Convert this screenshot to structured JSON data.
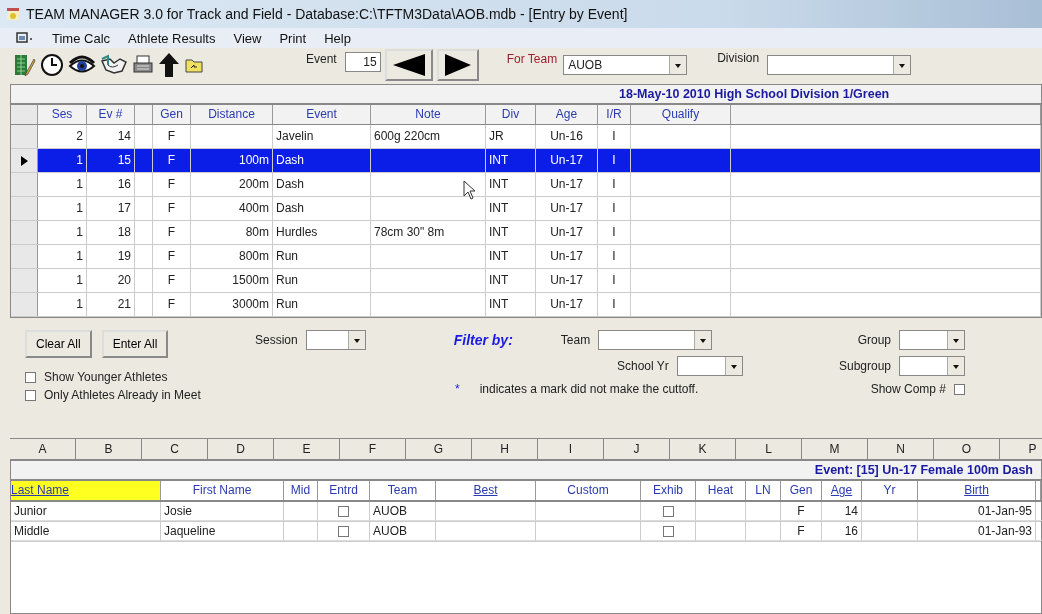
{
  "window": {
    "title": "TEAM MANAGER 3.0 for Track and Field - Database:C:\\TFTM3Data\\AOB.mdb - [Entry by Event]"
  },
  "menu": [
    "Time Calc",
    "Athlete Results",
    "View",
    "Print",
    "Help"
  ],
  "toolbar": {
    "event_label": "Event",
    "event_value": "15",
    "team_label": "For Team",
    "team_value": "AUOB",
    "division_label": "Division"
  },
  "meet_banner": "18-May-10  2010 High School Division 1/Green",
  "events": {
    "columns": [
      "Ses",
      "Ev #",
      "",
      "Gen",
      "Distance",
      "Event",
      "Note",
      "Div",
      "Age",
      "I/R",
      "Qualify"
    ],
    "rows": [
      {
        "selected": false,
        "cells": [
          "2",
          "14",
          "",
          "F",
          "",
          "Javelin",
          "600g 220cm",
          "JR",
          "Un-16",
          "I",
          ""
        ]
      },
      {
        "selected": true,
        "cells": [
          "1",
          "15",
          "",
          "F",
          "100m",
          "Dash",
          "",
          "INT",
          "Un-17",
          "I",
          ""
        ]
      },
      {
        "selected": false,
        "cells": [
          "1",
          "16",
          "",
          "F",
          "200m",
          "Dash",
          "",
          "INT",
          "Un-17",
          "I",
          ""
        ]
      },
      {
        "selected": false,
        "cells": [
          "1",
          "17",
          "",
          "F",
          "400m",
          "Dash",
          "",
          "INT",
          "Un-17",
          "I",
          ""
        ]
      },
      {
        "selected": false,
        "cells": [
          "1",
          "18",
          "",
          "F",
          "80m",
          "Hurdles",
          "78cm 30\" 8m",
          "INT",
          "Un-17",
          "I",
          ""
        ]
      },
      {
        "selected": false,
        "cells": [
          "1",
          "19",
          "",
          "F",
          "800m",
          "Run",
          "",
          "INT",
          "Un-17",
          "I",
          ""
        ]
      },
      {
        "selected": false,
        "cells": [
          "1",
          "20",
          "",
          "F",
          "1500m",
          "Run",
          "",
          "INT",
          "Un-17",
          "I",
          ""
        ]
      },
      {
        "selected": false,
        "cells": [
          "1",
          "21",
          "",
          "F",
          "3000m",
          "Run",
          "",
          "INT",
          "Un-17",
          "I",
          ""
        ]
      }
    ]
  },
  "filters": {
    "clear_button": "Clear All",
    "enter_button": "Enter All",
    "session_label": "Session",
    "filter_title": "Filter by:",
    "team_label": "Team",
    "school_yr_label": "School Yr",
    "group_label": "Group",
    "subgroup_label": "Subgroup",
    "options": [
      {
        "label": "Show Younger Athletes",
        "checked": false
      },
      {
        "label": "Only Athletes Already in Meet",
        "checked": false
      }
    ],
    "note_mark": "*",
    "note": "indicates a mark did not make the cuttoff.",
    "show_comp_label": "Show Comp #",
    "show_comp_checked": false
  },
  "letters": [
    "A",
    "B",
    "C",
    "D",
    "E",
    "F",
    "G",
    "H",
    "I",
    "J",
    "K",
    "L",
    "M",
    "N",
    "O",
    "P"
  ],
  "entries": {
    "banner": "Event: [15]  Un-17  Female   100m  Dash",
    "columns": [
      {
        "label": "Last Name",
        "sortable": true,
        "selected": true
      },
      {
        "label": "First Name",
        "sortable": false,
        "selected": false
      },
      {
        "label": "Mid",
        "sortable": false,
        "selected": false
      },
      {
        "label": "Entrd",
        "sortable": false,
        "selected": false
      },
      {
        "label": "Team",
        "sortable": false,
        "selected": false
      },
      {
        "label": "Best",
        "sortable": true,
        "selected": false
      },
      {
        "label": "Custom",
        "sortable": false,
        "selected": false
      },
      {
        "label": "Exhib",
        "sortable": false,
        "selected": false
      },
      {
        "label": "Heat",
        "sortable": false,
        "selected": false
      },
      {
        "label": "LN",
        "sortable": false,
        "selected": false
      },
      {
        "label": "Gen",
        "sortable": false,
        "selected": false
      },
      {
        "label": "Age",
        "sortable": true,
        "selected": false
      },
      {
        "label": "Yr",
        "sortable": false,
        "selected": false
      },
      {
        "label": "Birth",
        "sortable": true,
        "selected": false
      }
    ],
    "rows": [
      {
        "last": "Junior",
        "first": "Josie",
        "entered": false,
        "team": "AUOB",
        "exhib": false,
        "gen": "F",
        "age": "14",
        "birth": "01-Jan-95"
      },
      {
        "last": "Middle",
        "first": "Jaqueline",
        "entered": false,
        "team": "AUOB",
        "exhib": false,
        "gen": "F",
        "age": "16",
        "birth": "01-Jan-93"
      }
    ]
  }
}
